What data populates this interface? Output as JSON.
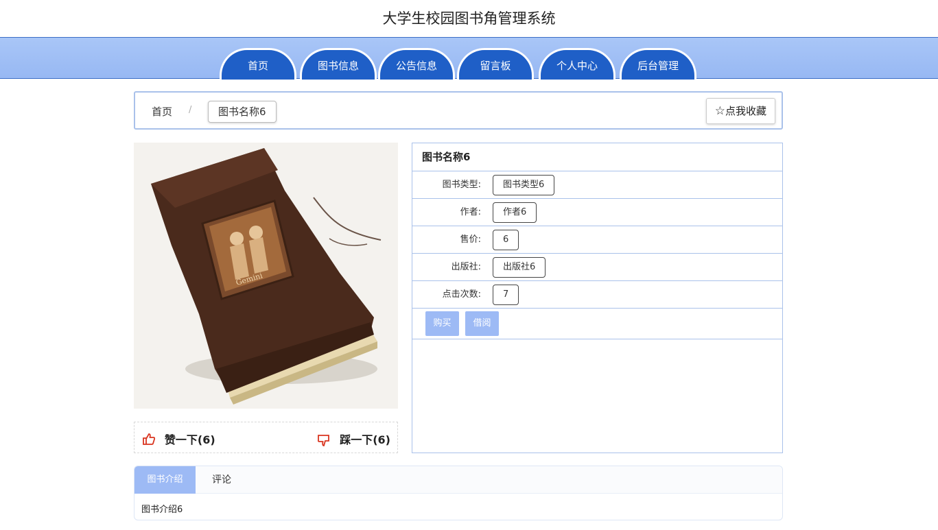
{
  "site": {
    "title": "大学生校园图书角管理系统"
  },
  "nav": {
    "items": [
      {
        "label": "首页"
      },
      {
        "label": "图书信息"
      },
      {
        "label": "公告信息"
      },
      {
        "label": "留言板"
      },
      {
        "label": "个人中心"
      },
      {
        "label": "后台管理"
      }
    ]
  },
  "breadcrumb": {
    "home": "首页",
    "separator": "/",
    "current": "图书名称6"
  },
  "favorite": {
    "icon": "star-outline-icon",
    "label": "点我收藏"
  },
  "book": {
    "name": "图书名称6",
    "fields": [
      {
        "label": "图书类型:",
        "value": "图书类型6"
      },
      {
        "label": "作者:",
        "value": "作者6"
      },
      {
        "label": "售价:",
        "value": "6"
      },
      {
        "label": "出版社:",
        "value": "出版社6"
      },
      {
        "label": "点击次数:",
        "value": "7"
      }
    ],
    "actions": {
      "buy": "购买",
      "borrow": "借阅"
    }
  },
  "votes": {
    "up_label": "赞一下(6)",
    "down_label": "踩一下(6)",
    "up_icon": "thumbs-up-icon",
    "down_icon": "thumbs-down-icon"
  },
  "tabs": {
    "items": [
      {
        "label": "图书介绍"
      },
      {
        "label": "评论"
      }
    ],
    "active_content": "图书介绍6"
  },
  "colors": {
    "nav_tab": "#1f5fc7",
    "nav_bar": "#a9c6f7",
    "button": "#9dbaf5",
    "vote_icon": "#d9341f"
  }
}
